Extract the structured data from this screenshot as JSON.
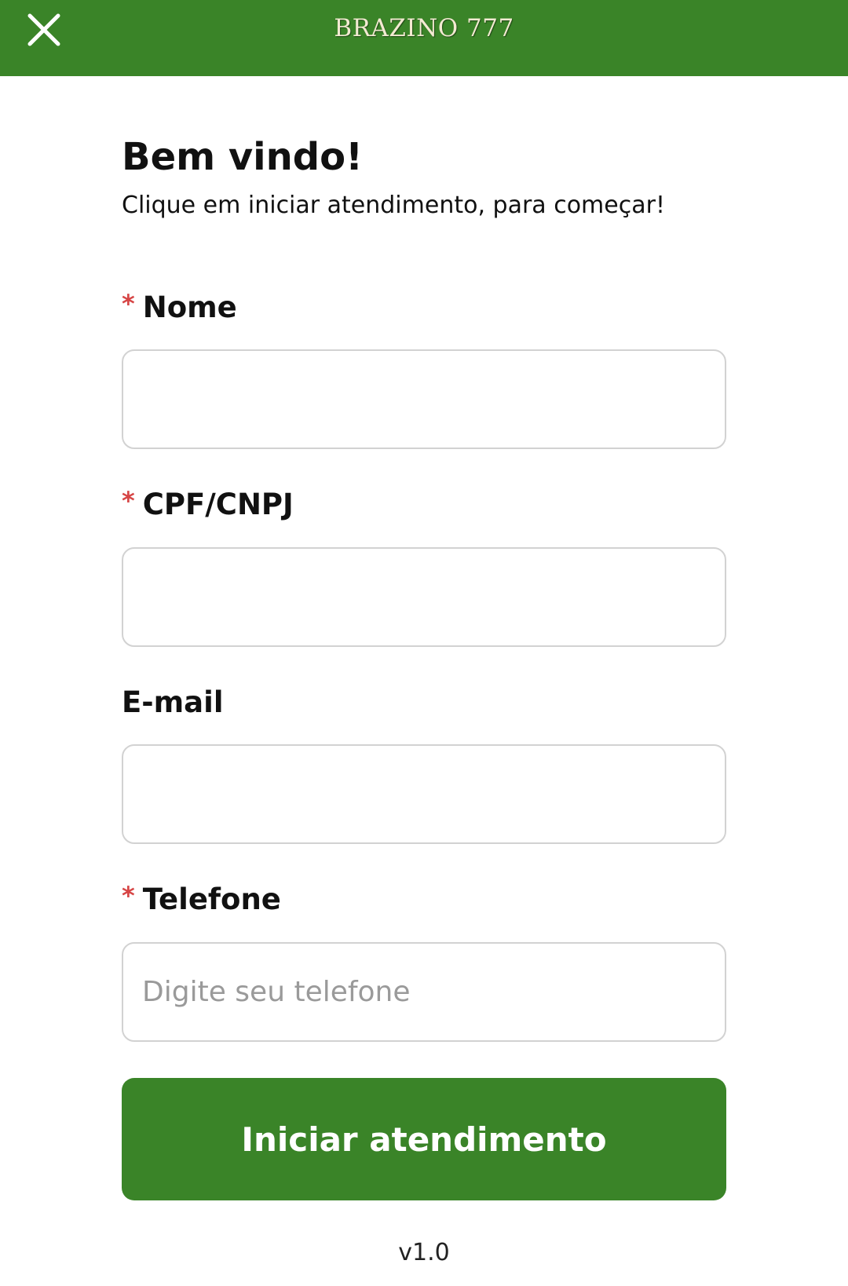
{
  "header": {
    "brand": "BRAZINO 777",
    "close_icon": "close-icon",
    "background_color": "#3a8428"
  },
  "welcome": {
    "title": "Bem vindo!",
    "subtitle": "Clique em iniciar atendimento, para começar!"
  },
  "form": {
    "fields": [
      {
        "label": "Nome",
        "required": true,
        "value": "",
        "placeholder": ""
      },
      {
        "label": "CPF/CNPJ",
        "required": true,
        "value": "",
        "placeholder": ""
      },
      {
        "label": "E-mail",
        "required": false,
        "value": "",
        "placeholder": ""
      },
      {
        "label": "Telefone",
        "required": true,
        "value": "",
        "placeholder": "Digite seu telefone"
      }
    ],
    "required_marker": "*",
    "required_color": "#d64545",
    "submit_label": "Iniciar atendimento",
    "button_color": "#3a8428"
  },
  "footer": {
    "version": "v1.0"
  }
}
